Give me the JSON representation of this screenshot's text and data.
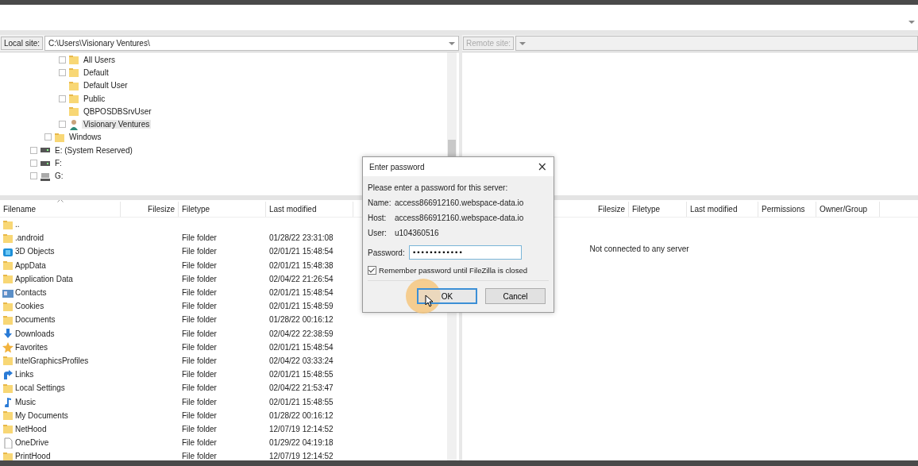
{
  "local_site": {
    "label": "Local site:",
    "path": "C:\\Users\\Visionary Ventures\\"
  },
  "remote_site": {
    "label": "Remote site:",
    "disabled": true
  },
  "local_tree": [
    {
      "children": [
        {
          "children": [
            {
              "label": "All Users",
              "kind": "folder",
              "expandable": true,
              "selected": false
            },
            {
              "label": "Default",
              "kind": "folder",
              "expandable": true,
              "selected": false
            },
            {
              "label": "Default User",
              "kind": "folder",
              "expandable": false,
              "selected": false
            },
            {
              "label": "Public",
              "kind": "folder",
              "expandable": true,
              "selected": false
            },
            {
              "label": "QBPOSDBSrvUser",
              "kind": "folder",
              "expandable": false,
              "selected": false
            },
            {
              "label": "Visionary Ventures",
              "kind": "user",
              "expandable": true,
              "selected": true
            }
          ]
        },
        {
          "label": "Windows",
          "kind": "folder",
          "expandable": true,
          "selected": false
        }
      ]
    },
    {
      "label": "E: (System Reserved)",
      "kind": "drive",
      "expandable": true,
      "selected": false
    },
    {
      "label": "F:",
      "kind": "drive",
      "expandable": true,
      "selected": false
    },
    {
      "label": "G:",
      "kind": "netdrive",
      "expandable": true,
      "selected": false
    }
  ],
  "local_files": {
    "columns": [
      "Filename",
      "Filesize",
      "Filetype",
      "Last modified"
    ],
    "rows": [
      {
        "kind": "folder",
        "name": ".."
      },
      {
        "kind": "folder",
        "name": ".android",
        "type": "File folder",
        "modified": "01/28/22 23:31:08"
      },
      {
        "kind": "cube",
        "name": "3D Objects",
        "type": "File folder",
        "modified": "02/01/21 15:48:54"
      },
      {
        "kind": "folder",
        "name": "AppData",
        "type": "File folder",
        "modified": "02/01/21 15:48:38"
      },
      {
        "kind": "folder",
        "name": "Application Data",
        "type": "File folder",
        "modified": "02/04/22 21:26:54"
      },
      {
        "kind": "contacts",
        "name": "Contacts",
        "type": "File folder",
        "modified": "02/01/21 15:48:54"
      },
      {
        "kind": "folder",
        "name": "Cookies",
        "type": "File folder",
        "modified": "02/01/21 15:48:59"
      },
      {
        "kind": "folder",
        "name": "Documents",
        "type": "File folder",
        "modified": "01/28/22 00:16:12"
      },
      {
        "kind": "download",
        "name": "Downloads",
        "type": "File folder",
        "modified": "02/04/22 22:38:59"
      },
      {
        "kind": "star",
        "name": "Favorites",
        "type": "File folder",
        "modified": "02/01/21 15:48:54"
      },
      {
        "kind": "folder",
        "name": "IntelGraphicsProfiles",
        "type": "File folder",
        "modified": "02/04/22 03:33:24"
      },
      {
        "kind": "link",
        "name": "Links",
        "type": "File folder",
        "modified": "02/01/21 15:48:55"
      },
      {
        "kind": "folder",
        "name": "Local Settings",
        "type": "File folder",
        "modified": "02/04/22 21:53:47"
      },
      {
        "kind": "music",
        "name": "Music",
        "type": "File folder",
        "modified": "02/01/21 15:48:55"
      },
      {
        "kind": "folder",
        "name": "My Documents",
        "type": "File folder",
        "modified": "01/28/22 00:16:12"
      },
      {
        "kind": "folder",
        "name": "NetHood",
        "type": "File folder",
        "modified": "12/07/19 12:14:52"
      },
      {
        "kind": "file",
        "name": "OneDrive",
        "type": "File folder",
        "modified": "01/29/22 04:19:18"
      },
      {
        "kind": "folder",
        "name": "PrintHood",
        "type": "File folder",
        "modified": "12/07/19 12:14:52"
      }
    ]
  },
  "remote_files": {
    "columns": [
      "Filesize",
      "Filetype",
      "Last modified",
      "Permissions",
      "Owner/Group"
    ],
    "message": "Not connected to any server"
  },
  "dialog": {
    "title": "Enter password",
    "close": "×",
    "intro": "Please enter a password for this server:",
    "fields": [
      {
        "label": "Name:",
        "value": "access866912160.webspace-data.io"
      },
      {
        "label": "Host:",
        "value": "access866912160.webspace-data.io"
      },
      {
        "label": "User:",
        "value": "u104360516"
      }
    ],
    "password_label": "Password:",
    "password": "••••••••••••",
    "remember": {
      "label": "Remember password until FileZilla is closed",
      "checked": true
    },
    "buttons": [
      {
        "label": "OK",
        "kind": "default"
      },
      {
        "label": "Cancel",
        "kind": "normal"
      }
    ]
  }
}
